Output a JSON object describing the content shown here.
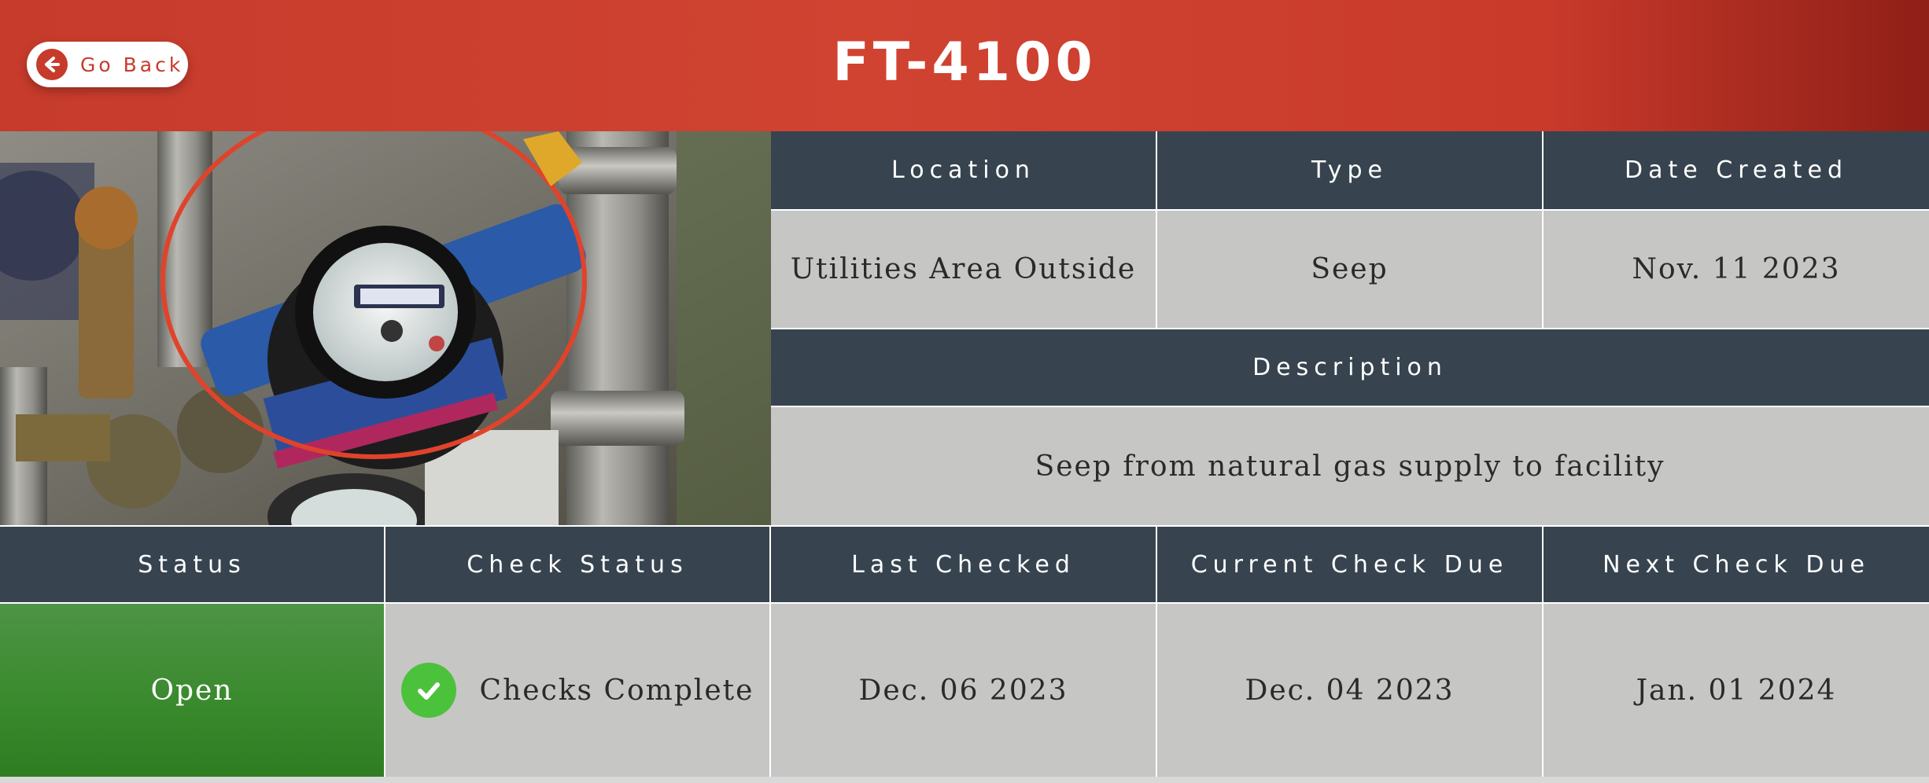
{
  "header": {
    "title": "FT-4100",
    "back_label": "Go Back"
  },
  "info_table": {
    "headers": {
      "location": "Location",
      "type": "Type",
      "date_created": "Date Created",
      "description": "Description"
    },
    "values": {
      "location": "Utilities Area Outside",
      "type": "Seep",
      "date_created": "Nov. 11 2023",
      "description": "Seep from natural gas supply to facility"
    }
  },
  "status_table": {
    "headers": {
      "status": "Status",
      "check_status": "Check Status",
      "last_checked": "Last Checked",
      "current_check_due": "Current Check Due",
      "next_check_due": "Next Check Due"
    },
    "values": {
      "status": "Open",
      "check_status": "Checks Complete",
      "last_checked": "Dec. 06 2023",
      "current_check_due": "Dec. 04 2023",
      "next_check_due": "Jan. 01 2024"
    }
  },
  "colors": {
    "header_red": "#c63b2c",
    "table_header": "#37444f",
    "table_cell": "#c6c7c4",
    "status_open": "#3a8a2e",
    "check_green": "#4cc13c"
  },
  "icons": {
    "back": "arrow-left-circle-icon",
    "check": "check-circle-icon"
  }
}
